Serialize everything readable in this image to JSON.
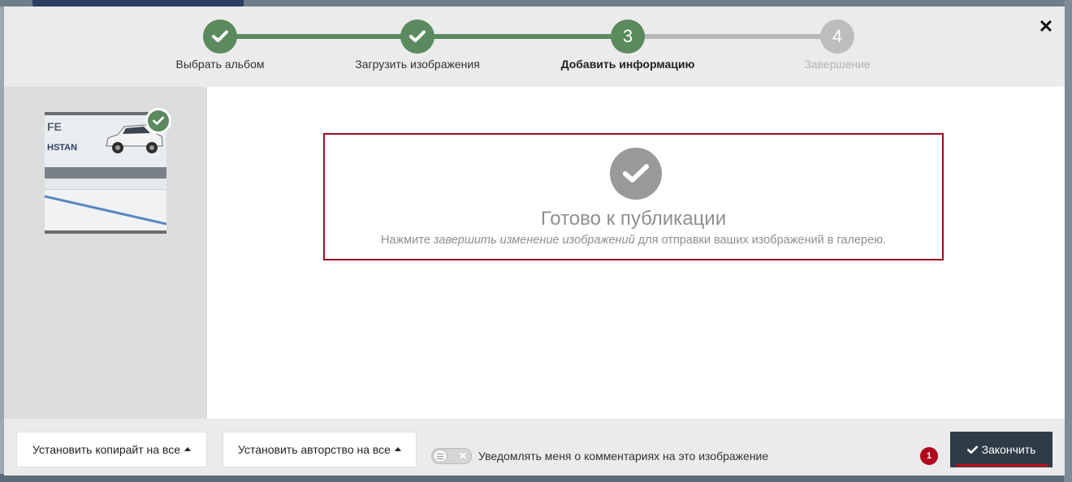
{
  "stepper": {
    "steps": [
      {
        "label": "Выбрать альбом",
        "state": "done"
      },
      {
        "label": "Загрузить изображения",
        "state": "done"
      },
      {
        "number": "3",
        "label": "Добавить информацию",
        "state": "active"
      },
      {
        "number": "4",
        "label": "Завершение",
        "state": "pending"
      }
    ],
    "close_symbol": "✕"
  },
  "thumbnail": {
    "text_top": "FE",
    "text_bottom": "HSTAN"
  },
  "ready": {
    "title": "Готово к публикации",
    "text_before": "Нажмите ",
    "text_emphasis": "завершить изменение изображений",
    "text_after": " для отправки ваших изображений в галерею."
  },
  "footer": {
    "copyright_button": "Установить копирайт на все",
    "author_button": "Установить авторство на все",
    "toggle_off_symbol": "✕",
    "notify_label": "Уведомлять меня о комментариях на это изображение",
    "badge_count": "1",
    "finish_button": "Закончить"
  },
  "colors": {
    "step_done": "#5a8a5e",
    "step_pending": "#bdbdbd",
    "alert_border": "#a00e20",
    "finish_bg": "#2f3b47",
    "badge": "#b0081d"
  },
  "icons": {
    "step_done": "check-icon",
    "close": "close-icon",
    "ready": "check-circle-icon",
    "finish": "check-icon",
    "caret": "caret-up-icon"
  }
}
